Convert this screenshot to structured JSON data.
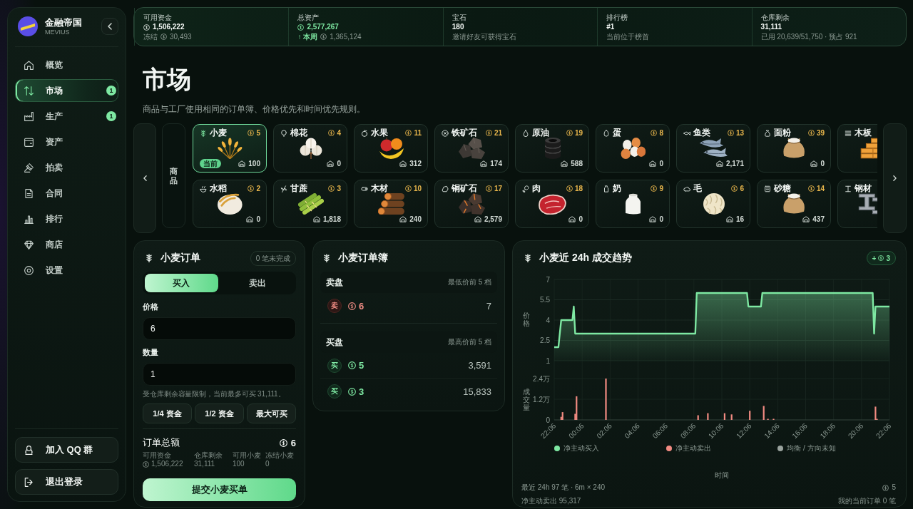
{
  "sidebar": {
    "brand_name": "金融帝国",
    "brand_subtitle": "MEVIUS",
    "nav": [
      {
        "label": "概览",
        "selected": false
      },
      {
        "label": "市场",
        "selected": true,
        "badge": "1"
      },
      {
        "label": "生产",
        "selected": false,
        "badge": "1"
      },
      {
        "label": "资产",
        "selected": false
      },
      {
        "label": "拍卖",
        "selected": false
      },
      {
        "label": "合同",
        "selected": false
      },
      {
        "label": "排行",
        "selected": false
      },
      {
        "label": "商店",
        "selected": false
      },
      {
        "label": "设置",
        "selected": false
      }
    ],
    "actions": [
      "加入 QQ 群",
      "退出登录"
    ]
  },
  "stats": [
    {
      "label": "可用资金",
      "value": "1,506,222",
      "value_coin": true,
      "value_positive": false,
      "note": "冻结",
      "note_amount": "30,493",
      "note_positive": false
    },
    {
      "label": "总资产",
      "value": "2,577,267",
      "value_coin": true,
      "value_positive": true,
      "note": "↑ 本周",
      "note_amount": "1,365,124",
      "note_positive": true
    },
    {
      "label": "宝石",
      "value": "180",
      "value_positive": false,
      "note": "邀请好友可获得宝石",
      "note_positive": false
    },
    {
      "label": "排行榜",
      "value": "#1",
      "value_positive": false,
      "note": "当前位于榜首",
      "note_positive": false
    },
    {
      "label": "仓库剩余",
      "value": "31,111",
      "value_positive": false,
      "note": "已用 20,639/51,750 · 预占 921",
      "note_positive": false
    }
  ],
  "header": {
    "title": "市场",
    "subtitle": "商品与工厂使用相同的订单簿、价格优先和时间优先规则。"
  },
  "products": {
    "label": "商品",
    "rows": [
      [
        {
          "name": "小麦",
          "price": "5",
          "stock": "100",
          "selected": true,
          "tag": "当前"
        },
        {
          "name": "棉花",
          "price": "4",
          "stock": "0",
          "selected": false
        },
        {
          "name": "水果",
          "price": "11",
          "stock": "312",
          "selected": false
        },
        {
          "name": "铁矿石",
          "price": "21",
          "stock": "174",
          "selected": false
        },
        {
          "name": "原油",
          "price": "19",
          "stock": "588",
          "selected": false
        },
        {
          "name": "蛋",
          "price": "8",
          "stock": "0",
          "selected": false
        },
        {
          "name": "鱼类",
          "price": "13",
          "stock": "2,171",
          "selected": false
        },
        {
          "name": "面粉",
          "price": "39",
          "stock": "0",
          "selected": false
        },
        {
          "name": "木板",
          "selected": false
        }
      ],
      [
        {
          "name": "水稻",
          "price": "2",
          "stock": "0",
          "selected": false
        },
        {
          "name": "甘蔗",
          "price": "3",
          "stock": "1,818",
          "selected": false
        },
        {
          "name": "木材",
          "price": "10",
          "stock": "240",
          "selected": false
        },
        {
          "name": "铜矿石",
          "price": "17",
          "stock": "2,579",
          "selected": false
        },
        {
          "name": "肉",
          "price": "18",
          "stock": "0",
          "selected": false
        },
        {
          "name": "奶",
          "price": "9",
          "stock": "0",
          "selected": false
        },
        {
          "name": "毛",
          "price": "6",
          "stock": "16",
          "selected": false
        },
        {
          "name": "砂糖",
          "price": "14",
          "stock": "437",
          "selected": false
        },
        {
          "name": "钢材",
          "selected": false
        }
      ]
    ]
  },
  "order_form": {
    "title": "小麦订单",
    "pending": "0 笔未完成",
    "sides": [
      {
        "label": "买入",
        "selected": true
      },
      {
        "label": "卖出",
        "selected": false
      }
    ],
    "fields": [
      {
        "label": "价格",
        "value": "6"
      },
      {
        "label": "数量",
        "value": "1"
      }
    ],
    "hint": "受仓库剩余容量限制，当前最多可买 31,111。",
    "quick_amounts": [
      "1/4 资金",
      "1/2 资金",
      "最大可买"
    ],
    "total_label": "订单总额",
    "total": "6",
    "summary": [
      {
        "label": "可用资金",
        "value": "1,506,222",
        "coin": true
      },
      {
        "label": "仓库剩余",
        "value": "31,111"
      },
      {
        "label": "可用小麦",
        "value": "100"
      },
      {
        "label": "冻结小麦",
        "value": "0"
      }
    ],
    "submit": "提交小麦买单"
  },
  "order_book": {
    "title": "小麦订单簿",
    "sections": [
      {
        "kind": "sell",
        "title": "卖盘",
        "note": "最低价前 5 档",
        "rows": [
          {
            "side": "卖",
            "price": "6",
            "quantity": "7"
          }
        ]
      },
      {
        "kind": "buy",
        "title": "买盘",
        "note": "最高价前 5 档",
        "rows": [
          {
            "side": "买",
            "price": "5",
            "quantity": "3,591"
          },
          {
            "side": "买",
            "price": "3",
            "quantity": "15,833"
          }
        ]
      }
    ]
  },
  "trend": {
    "title": "小麦近 24h 成交趋势",
    "change_sign": "+",
    "change": "3",
    "price_chart": {
      "chart_data": {
        "type": "area",
        "ylabel": "价格",
        "grid": true,
        "categories": [
          null,
          null,
          null,
          null,
          null,
          null,
          null,
          null,
          null,
          null,
          null,
          null,
          null,
          null,
          null,
          null,
          null,
          null,
          null,
          null,
          null,
          null,
          null,
          null,
          null,
          null,
          null,
          null,
          null,
          null,
          null,
          null,
          null,
          null,
          null,
          null,
          null,
          null,
          null,
          null,
          null,
          null,
          null,
          null,
          null,
          null,
          null,
          null,
          null,
          null,
          null,
          null,
          null,
          null,
          null,
          null,
          null,
          null,
          null,
          null,
          null,
          null,
          null,
          null,
          null,
          null,
          null,
          null,
          null,
          null,
          null,
          null,
          null,
          null,
          null,
          null,
          null,
          null,
          null,
          null,
          null,
          null,
          null,
          null,
          null,
          null,
          null,
          null,
          null,
          null,
          null,
          null,
          null,
          null,
          null,
          null,
          null,
          null,
          null,
          null,
          null,
          null,
          null,
          null,
          null,
          null,
          null,
          null,
          null,
          null,
          null,
          null,
          null,
          null,
          null,
          null,
          null,
          null,
          null,
          null,
          null,
          null,
          null,
          null,
          null,
          null,
          null,
          null,
          null,
          null,
          null,
          null,
          null,
          null,
          null,
          null,
          null,
          null,
          null,
          null,
          null,
          null,
          null,
          null,
          null,
          null,
          null,
          null,
          null,
          null,
          null,
          null,
          null,
          null,
          null,
          null,
          null,
          null,
          null,
          null,
          null,
          null,
          null,
          null,
          null,
          null,
          null,
          null,
          null,
          null,
          null,
          null,
          null,
          null,
          null,
          null,
          null,
          null,
          null,
          null,
          null,
          null,
          null,
          null,
          null,
          null,
          null,
          null,
          null,
          null,
          null,
          null,
          null,
          null,
          null,
          null,
          null,
          null,
          null,
          null,
          null,
          null,
          null,
          null,
          null,
          null,
          null,
          null,
          null,
          null,
          null,
          null,
          null,
          null,
          null,
          null,
          null,
          null,
          null,
          null,
          null,
          null,
          null,
          null,
          null,
          null,
          null,
          null,
          null,
          null,
          null,
          null,
          null,
          null,
          null,
          null,
          null,
          null,
          null,
          null,
          null
        ],
        "series": [
          {
            "color": "#7ee8a2",
            "values": [
              2,
              2,
              2,
              2,
              3,
              4,
              4,
              4,
              4,
              4,
              4,
              4,
              4,
              4,
              5,
              3,
              3,
              3,
              3,
              3,
              3,
              3,
              3,
              3,
              3,
              3,
              3,
              3,
              3,
              3,
              3,
              3,
              3,
              3,
              3,
              3,
              3,
              3,
              3,
              3,
              3,
              3,
              3,
              3,
              3,
              3,
              3,
              3,
              3,
              3,
              3,
              3,
              3,
              3,
              3,
              3,
              3,
              3,
              3,
              3,
              3,
              3,
              3,
              3,
              3,
              3,
              3,
              3,
              3,
              3,
              3,
              3,
              3,
              3,
              3,
              3,
              3,
              3,
              3,
              3,
              3,
              3,
              3,
              3,
              3,
              3,
              3,
              3,
              3,
              3,
              3,
              3,
              3,
              3,
              3,
              3,
              3,
              3,
              3,
              3,
              3,
              3,
              6,
              6,
              6,
              6,
              6,
              6,
              6,
              6,
              6,
              6,
              6,
              6,
              6,
              6,
              6,
              6,
              6,
              6,
              6,
              6,
              6,
              6,
              6,
              6,
              6,
              6,
              6,
              6,
              6,
              6,
              6,
              6,
              6,
              6,
              6,
              6,
              6,
              5,
              5,
              5,
              5,
              5,
              5,
              5,
              5,
              5,
              5,
              6,
              6,
              6,
              6,
              6,
              6,
              6,
              6,
              6,
              6,
              6,
              6,
              6,
              6,
              6,
              6,
              6,
              6,
              6,
              6,
              6,
              6,
              6,
              6,
              6,
              6,
              6,
              6,
              6,
              6,
              6,
              6,
              6,
              6,
              6,
              6,
              6,
              6,
              6,
              6,
              6,
              6,
              6,
              6,
              6,
              6,
              6,
              6,
              6,
              6,
              6,
              6,
              6,
              6,
              6,
              6,
              6,
              6,
              6,
              6,
              6,
              6,
              6,
              6,
              6,
              6,
              6,
              6,
              6,
              6,
              6,
              6,
              6,
              6,
              6,
              6,
              6,
              6,
              6,
              6,
              3,
              5,
              5,
              5,
              5,
              5,
              5,
              5,
              5,
              5,
              5,
              5
            ]
          }
        ],
        "ylim": [
          1,
          7
        ],
        "yticks": [
          1,
          2.5,
          4,
          5.5,
          7
        ]
      }
    },
    "volume_chart": {
      "chart_data": {
        "type": "bar",
        "xlabel": "时间",
        "ylabel": "成交量",
        "grid": true,
        "categories": [
          "22:06",
          null,
          null,
          null,
          null,
          null,
          null,
          null,
          null,
          null,
          null,
          null,
          null,
          null,
          null,
          null,
          null,
          null,
          null,
          null,
          "00:06",
          null,
          null,
          null,
          null,
          null,
          null,
          null,
          null,
          null,
          null,
          null,
          null,
          null,
          null,
          null,
          null,
          null,
          null,
          null,
          "02:06",
          null,
          null,
          null,
          null,
          null,
          null,
          null,
          null,
          null,
          null,
          null,
          null,
          null,
          null,
          null,
          null,
          null,
          null,
          null,
          "04:06",
          null,
          null,
          null,
          null,
          null,
          null,
          null,
          null,
          null,
          null,
          null,
          null,
          null,
          null,
          null,
          null,
          null,
          null,
          null,
          "06:06",
          null,
          null,
          null,
          null,
          null,
          null,
          null,
          null,
          null,
          null,
          null,
          null,
          null,
          null,
          null,
          null,
          null,
          null,
          null,
          "08:06",
          null,
          null,
          null,
          null,
          null,
          null,
          null,
          null,
          null,
          null,
          null,
          null,
          null,
          null,
          null,
          null,
          null,
          null,
          null,
          "10:06",
          null,
          null,
          null,
          null,
          null,
          null,
          null,
          null,
          null,
          null,
          null,
          null,
          null,
          null,
          null,
          null,
          null,
          null,
          null,
          "12:06",
          null,
          null,
          null,
          null,
          null,
          null,
          null,
          null,
          null,
          null,
          null,
          null,
          null,
          null,
          null,
          null,
          null,
          null,
          null,
          "14:06",
          null,
          null,
          null,
          null,
          null,
          null,
          null,
          null,
          null,
          null,
          null,
          null,
          null,
          null,
          null,
          null,
          null,
          null,
          null,
          "16:06",
          null,
          null,
          null,
          null,
          null,
          null,
          null,
          null,
          null,
          null,
          null,
          null,
          null,
          null,
          null,
          null,
          null,
          null,
          null,
          "18:06",
          null,
          null,
          null,
          null,
          null,
          null,
          null,
          null,
          null,
          null,
          null,
          null,
          null,
          null,
          null,
          null,
          null,
          null,
          null,
          "20:06",
          null,
          null,
          null,
          null,
          null,
          null,
          null,
          null,
          null,
          null,
          null,
          null,
          null,
          null,
          null,
          null,
          null,
          null,
          null,
          "22:06"
        ],
        "series": [
          {
            "name": "净主动买入",
            "color": "#7ee8a2",
            "values": [
              null,
              null,
              null,
              null,
              null,
              null,
              null,
              null,
              null,
              null,
              null,
              null,
              null,
              null,
              null,
              null,
              null,
              null,
              null,
              null,
              null,
              null,
              null,
              null,
              null,
              null,
              null,
              null,
              null,
              null,
              null,
              null,
              null,
              null,
              null,
              null,
              null,
              null,
              null,
              null,
              null,
              null,
              null,
              null,
              null,
              null,
              null,
              null,
              null,
              null,
              null,
              null,
              null,
              null,
              null,
              null,
              null,
              null,
              null,
              null,
              null,
              null,
              null,
              null,
              null,
              null,
              null,
              null,
              null,
              null,
              null,
              null,
              null,
              null,
              null,
              null,
              null,
              null,
              null,
              null,
              null,
              null,
              null,
              null,
              null,
              null,
              null,
              null,
              null,
              null,
              null,
              null,
              null,
              null,
              null,
              null,
              null,
              null,
              null,
              null,
              null,
              null,
              null,
              null,
              null,
              null,
              null,
              null,
              null,
              null,
              null,
              null,
              null,
              null,
              null,
              null,
              null,
              null,
              null,
              null,
              null,
              null,
              null,
              null,
              null,
              null,
              null,
              null,
              null,
              null,
              null,
              null,
              null,
              null,
              null,
              null,
              null,
              null,
              null,
              null,
              null,
              null,
              null,
              null,
              null,
              null,
              null,
              null,
              null,
              null,
              null,
              null,
              null,
              null,
              null,
              null,
              null,
              null,
              null,
              null,
              null,
              null,
              null,
              null,
              null,
              null,
              null,
              null,
              null,
              null,
              null,
              null,
              null,
              null,
              null,
              null,
              null,
              null,
              null,
              null,
              null,
              null,
              null,
              null,
              null,
              null,
              null,
              null,
              null,
              null,
              null,
              null,
              null,
              null,
              null,
              null,
              null,
              null,
              null,
              null,
              null,
              null,
              null,
              null,
              null,
              null,
              null,
              null,
              null,
              null,
              null,
              null,
              null,
              null,
              null,
              null,
              null,
              null,
              null,
              null,
              null,
              null,
              null,
              null,
              null,
              null,
              null,
              null,
              null,
              null,
              null,
              null,
              null,
              null,
              null,
              null,
              null,
              null,
              null,
              null,
              null
            ]
          },
          {
            "name": "净主动卖出",
            "color": "#f28b82",
            "values": [
              null,
              null,
              null,
              null,
              null,
              0.18,
              0.45,
              null,
              null,
              null,
              null,
              null,
              null,
              null,
              null,
              0.35,
              1.37,
              null,
              null,
              null,
              null,
              null,
              null,
              null,
              null,
              null,
              null,
              null,
              null,
              null,
              null,
              null,
              null,
              null,
              null,
              null,
              null,
              2.4,
              null,
              null,
              null,
              null,
              null,
              null,
              null,
              null,
              null,
              null,
              null,
              null,
              null,
              null,
              null,
              null,
              null,
              null,
              null,
              null,
              null,
              null,
              null,
              null,
              null,
              null,
              null,
              null,
              null,
              null,
              null,
              null,
              null,
              null,
              null,
              null,
              null,
              null,
              null,
              null,
              null,
              null,
              null,
              null,
              null,
              null,
              null,
              null,
              null,
              null,
              null,
              null,
              null,
              null,
              null,
              null,
              null,
              null,
              null,
              null,
              null,
              null,
              null,
              null,
              null,
              0.27,
              null,
              null,
              null,
              null,
              null,
              null,
              0.39,
              null,
              null,
              null,
              null,
              null,
              null,
              null,
              null,
              null,
              null,
              null,
              0.39,
              null,
              null,
              null,
              null,
              0.32,
              null,
              null,
              null,
              null,
              null,
              null,
              null,
              null,
              null,
              null,
              null,
              null,
              0.53,
              null,
              null,
              null,
              null,
              null,
              null,
              null,
              null,
              null,
              0.81,
              null,
              null,
              0.03,
              null,
              null,
              null,
              0.03,
              null,
              null,
              null,
              null,
              null,
              null,
              null,
              null,
              null,
              null,
              null,
              null,
              null,
              null,
              null,
              null,
              null,
              null,
              null,
              null,
              null,
              null,
              null,
              null,
              null,
              null,
              null,
              null,
              null,
              null,
              null,
              null,
              null,
              null,
              null,
              null,
              null,
              null,
              null,
              null,
              null,
              null,
              null,
              null,
              null,
              null,
              null,
              null,
              null,
              null,
              null,
              null,
              null,
              null,
              null,
              null,
              null,
              null,
              null,
              null,
              null,
              null,
              null,
              null,
              null,
              null,
              null,
              null,
              null,
              null,
              null,
              null,
              0.77,
              0.05,
              null,
              null,
              null,
              null,
              null,
              null,
              null,
              null,
              null
            ]
          },
          {
            "name": "均衡 / 方向未知",
            "color": "#9aa39e",
            "values": [
              null,
              null,
              null,
              null,
              null,
              null,
              null,
              null,
              null,
              null,
              null,
              null,
              null,
              null,
              null,
              null,
              null,
              null,
              null,
              null,
              null,
              null,
              null,
              null,
              null,
              null,
              null,
              null,
              null,
              null,
              null,
              null,
              null,
              null,
              null,
              null,
              null,
              null,
              null,
              null,
              null,
              null,
              null,
              null,
              null,
              null,
              null,
              null,
              null,
              null,
              null,
              null,
              null,
              null,
              null,
              null,
              null,
              null,
              null,
              null,
              null,
              null,
              null,
              null,
              null,
              null,
              null,
              null,
              null,
              null,
              null,
              null,
              null,
              null,
              null,
              null,
              null,
              null,
              null,
              null,
              null,
              null,
              null,
              null,
              null,
              null,
              null,
              null,
              null,
              null,
              null,
              null,
              null,
              null,
              null,
              null,
              null,
              null,
              null,
              null,
              null,
              null,
              null,
              null,
              null,
              null,
              null,
              null,
              null,
              null,
              null,
              null,
              null,
              null,
              null,
              null,
              null,
              null,
              null,
              null,
              null,
              null,
              null,
              null,
              null,
              null,
              null,
              null,
              null,
              null,
              null,
              null,
              null,
              null,
              null,
              null,
              null,
              null,
              null,
              null,
              null,
              null,
              null,
              null,
              null,
              null,
              null,
              null,
              null,
              null,
              null,
              null,
              null,
              null,
              null,
              null,
              null,
              null,
              null,
              null,
              null,
              null,
              null,
              null,
              null,
              null,
              null,
              null,
              null,
              null,
              null,
              null,
              null,
              null,
              null,
              null,
              null,
              null,
              null,
              null,
              null,
              null,
              null,
              null,
              null,
              null,
              null,
              null,
              null,
              null,
              null,
              null,
              null,
              null,
              null,
              null,
              null,
              null,
              null,
              null,
              null,
              null,
              null,
              null,
              null,
              null,
              null,
              null,
              null,
              null,
              null,
              null,
              null,
              null,
              null,
              null,
              null,
              null,
              null,
              null,
              null,
              null,
              null,
              null,
              null,
              null,
              null,
              null,
              null,
              null,
              null,
              null,
              null,
              null,
              null,
              null,
              null,
              null,
              null,
              null,
              null
            ]
          }
        ],
        "ylim": [
          0,
          2.4
        ],
        "yticks": [
          0,
          {
            "value": 1.2,
            "label": "1.2万"
          },
          {
            "value": 2.4,
            "label": "2.4万"
          }
        ]
      }
    },
    "footer_left": [
      "最近 24h 97 笔 · 6m × 240",
      "净主动卖出 95,317"
    ],
    "footer_right": [
      {
        "coin": true,
        "text": "5"
      },
      {
        "text": "我的当前订单 0 笔"
      }
    ]
  }
}
